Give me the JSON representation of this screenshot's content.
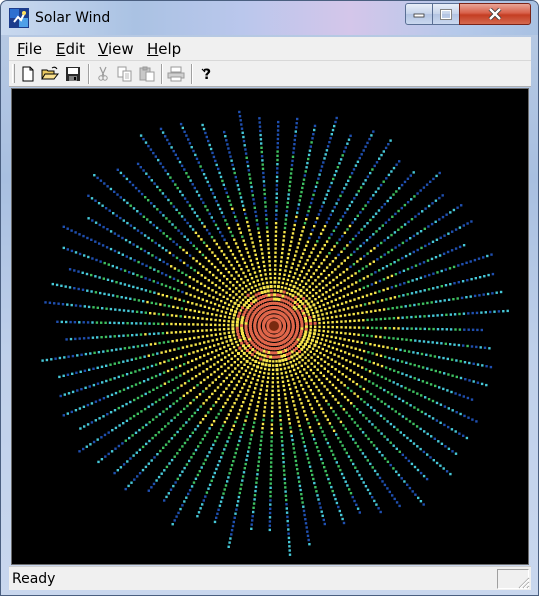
{
  "window": {
    "title": "Solar Wind"
  },
  "menu": {
    "items": [
      {
        "label": "File",
        "mnemonic": "F",
        "rest": "ile"
      },
      {
        "label": "Edit",
        "mnemonic": "E",
        "rest": "dit"
      },
      {
        "label": "View",
        "mnemonic": "V",
        "rest": "iew"
      },
      {
        "label": "Help",
        "mnemonic": "H",
        "rest": "elp"
      }
    ]
  },
  "toolbar": {
    "buttons": [
      {
        "icon": "new-document-icon",
        "enabled": true
      },
      {
        "icon": "open-folder-icon",
        "enabled": true
      },
      {
        "icon": "save-disk-icon",
        "enabled": true
      },
      {
        "icon": "cut-scissors-icon",
        "enabled": false
      },
      {
        "icon": "copy-icon",
        "enabled": false
      },
      {
        "icon": "paste-icon",
        "enabled": false
      },
      {
        "icon": "print-icon",
        "enabled": false
      },
      {
        "icon": "help-question-icon",
        "enabled": true
      }
    ]
  },
  "canvas": {
    "background": "#000000",
    "palette": [
      "#e0664a",
      "#f7e64a",
      "#3ec060",
      "#46c8d8",
      "#1f4fb0"
    ]
  },
  "status": {
    "text": "Ready"
  }
}
